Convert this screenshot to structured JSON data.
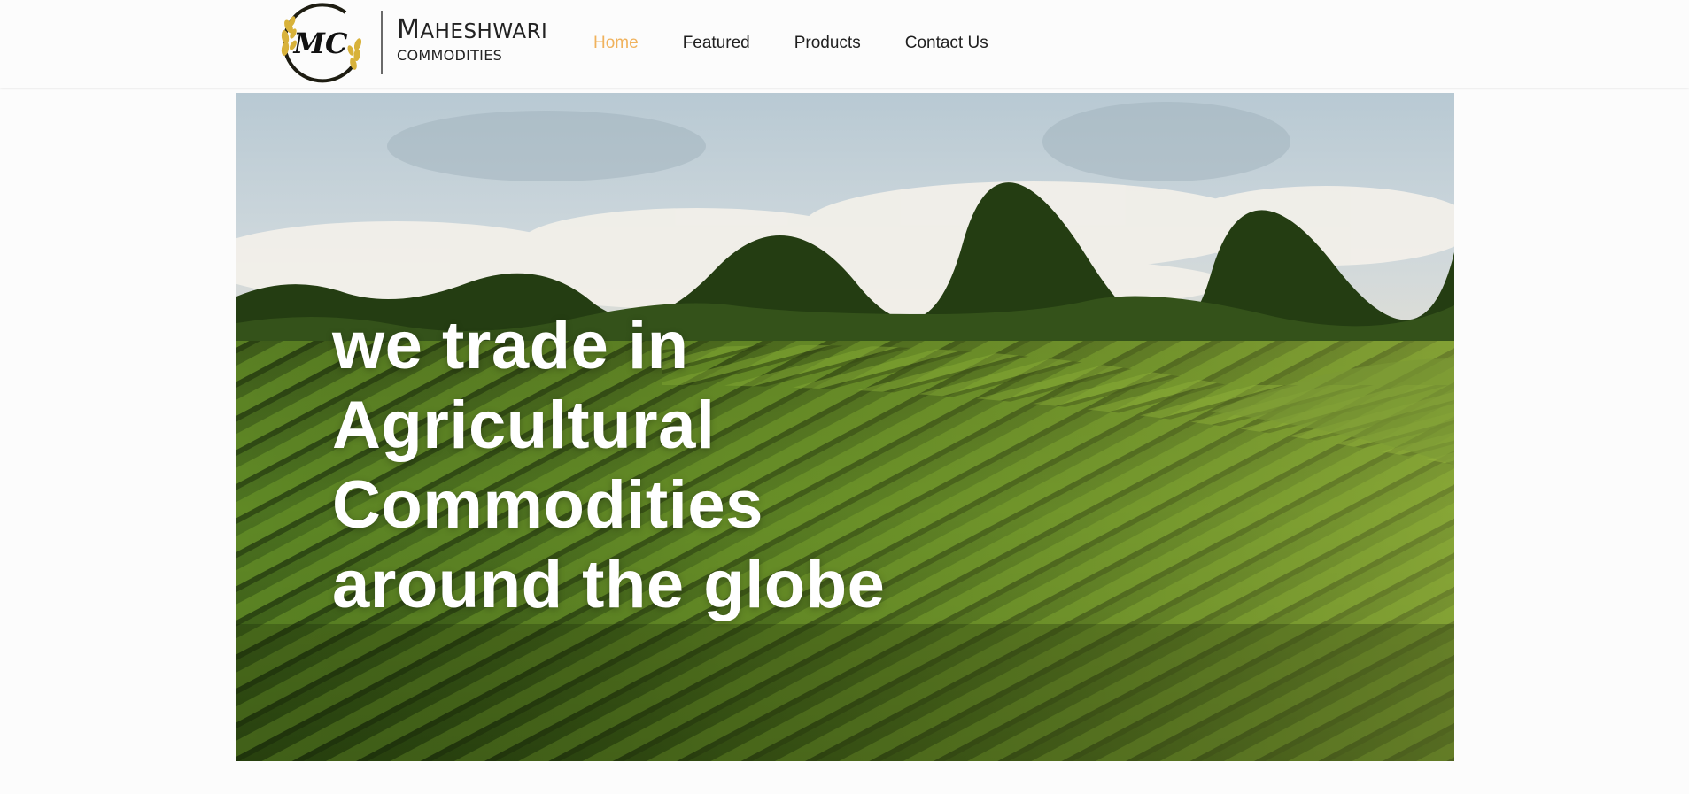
{
  "brand": {
    "logo_initials": "MC",
    "name_first_letter": "M",
    "name_rest": "AHESHWARI",
    "subtitle": "COMMODITIES",
    "icon": "wheat-ring-logo-icon"
  },
  "nav": {
    "items": [
      {
        "label": "Home",
        "active": true
      },
      {
        "label": "Featured",
        "active": false
      },
      {
        "label": "Products",
        "active": false
      },
      {
        "label": "Contact Us",
        "active": false
      }
    ]
  },
  "hero": {
    "lines": [
      "we trade in",
      "Agricultural",
      "Commodities",
      "around the globe"
    ]
  },
  "colors": {
    "accent": "#f0b25c",
    "nav_text": "#1f1f1f",
    "logo_gold": "#d8b23a",
    "hero_text": "#ffffff"
  }
}
